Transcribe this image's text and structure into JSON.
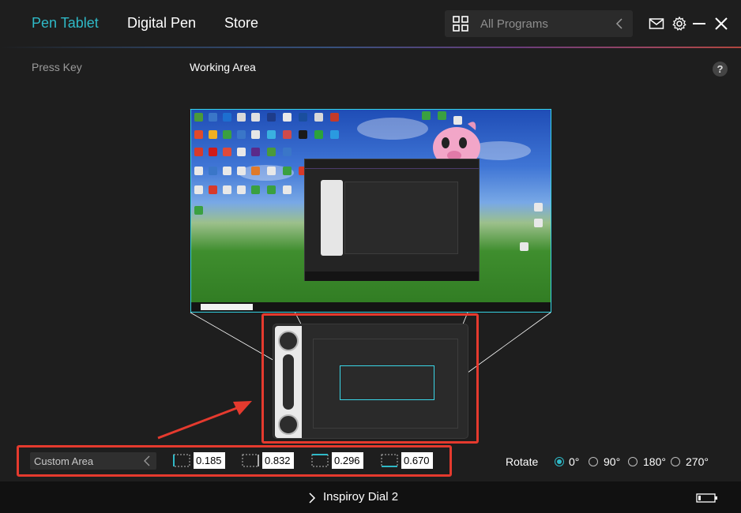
{
  "nav": {
    "tabs": [
      {
        "label": "Pen Tablet"
      },
      {
        "label": "Digital Pen"
      },
      {
        "label": "Store"
      }
    ],
    "program_placeholder": "All Programs"
  },
  "sections": {
    "press_key": "Press Key",
    "working_area": "Working Area",
    "help": "?"
  },
  "area": {
    "mode": "Custom Area",
    "values": [
      "0.185",
      "0.832",
      "0.296",
      "0.670"
    ]
  },
  "rotate": {
    "label": "Rotate",
    "options": [
      "0°",
      "90°",
      "180°",
      "270°"
    ],
    "selected": "0°"
  },
  "footer": {
    "device": "Inspiroy Dial 2"
  },
  "colors": {
    "accent": "#2fb9c7",
    "highlight": "#e53a2e"
  },
  "icons": {
    "grid": "grid-icon",
    "mail": "mail-icon",
    "settings": "gear-icon",
    "minimize": "minimize-icon",
    "close": "close-icon",
    "battery": "battery-icon"
  }
}
